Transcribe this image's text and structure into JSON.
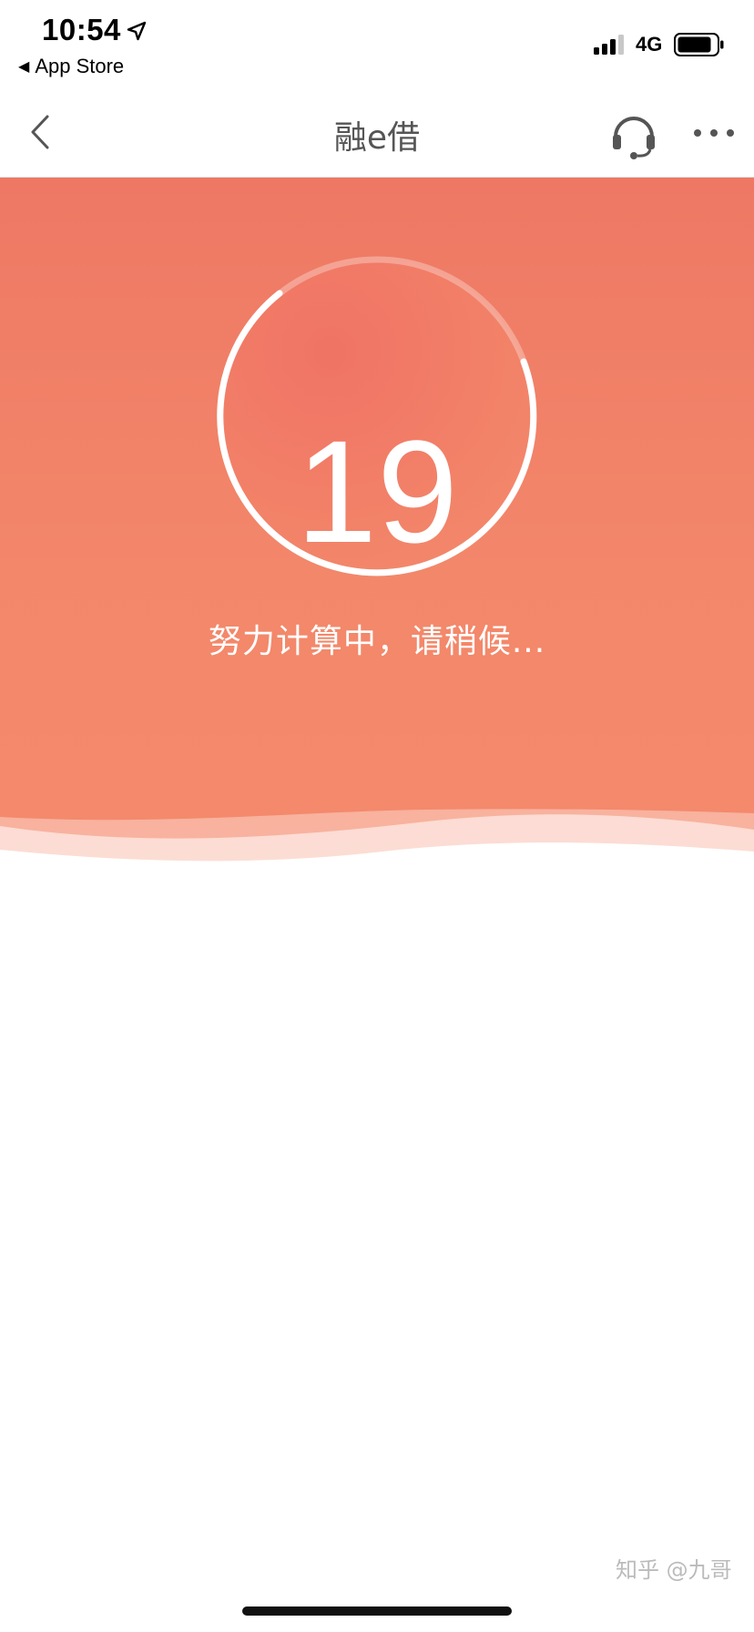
{
  "status_bar": {
    "time": "10:54",
    "back_app_label": "App Store",
    "network": "4G",
    "icons": [
      "location-arrow-icon",
      "cellular-signal-icon",
      "battery-icon"
    ]
  },
  "nav": {
    "title": "融e借",
    "icons": [
      "chevron-left-icon",
      "headset-icon",
      "more-dots-icon"
    ]
  },
  "hero": {
    "countdown_value": "19",
    "loading_text": "努力计算中，请稍候...",
    "colors": {
      "background_top": "#ee7864",
      "background_bottom": "#f48a6c",
      "text": "#ffffff"
    }
  },
  "watermark": "知乎 @九哥"
}
